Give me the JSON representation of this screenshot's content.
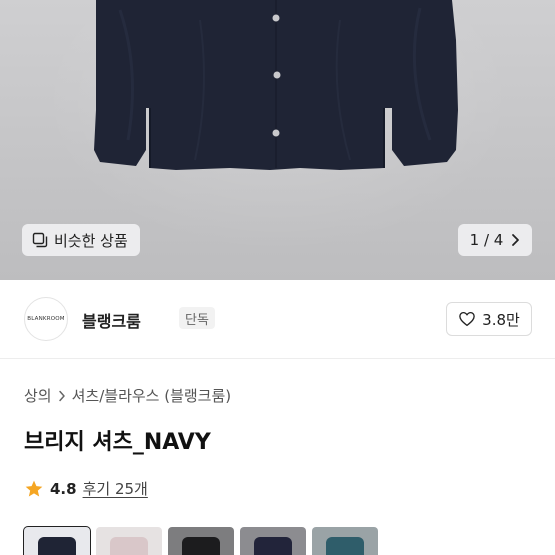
{
  "hero": {
    "similar_label": "비슷한 상품",
    "similar_icon": "similar-items-icon",
    "pager_text": "1 / 4",
    "pager_icon": "chevron-right-icon",
    "shirt_color": "#1f2435"
  },
  "brand": {
    "logo_text": "BLANKROOM",
    "name": "블랭크룸",
    "tag": "단독",
    "like_icon": "heart-icon",
    "like_count": "3.8만"
  },
  "breadcrumb": {
    "items": [
      "상의",
      "셔츠/블라우스 (블랭크룸)"
    ],
    "separator_icon": "chevron-right-icon"
  },
  "product": {
    "title": "브리지 셔츠_NAVY"
  },
  "rating": {
    "star_icon": "star-icon",
    "score": "4.8",
    "reviews": "후기 25개",
    "star_color": "#f5a623"
  },
  "color_options": [
    {
      "bg": "#e8e9ed",
      "shirt": "#1f2435",
      "selected": true
    },
    {
      "bg": "#e6e2e2",
      "shirt": "#d9c7c9",
      "selected": false
    },
    {
      "bg": "#7d7d7f",
      "shirt": "#1c1c1e",
      "selected": false
    },
    {
      "bg": "#8c8c90",
      "shirt": "#22243a",
      "selected": false
    },
    {
      "bg": "#9aa3a6",
      "shirt": "#2f5d6a",
      "selected": false
    }
  ]
}
